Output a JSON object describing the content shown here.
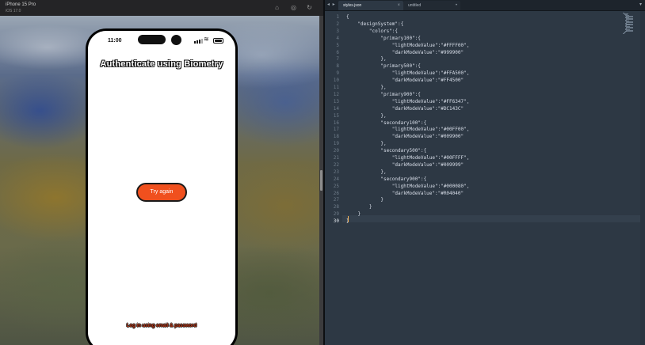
{
  "simulator": {
    "title": "iPhone 15 Pro",
    "subtitle": "iOS 17.0",
    "toolbar_icons": [
      "home-icon",
      "screenshot-icon",
      "rotate-icon"
    ],
    "status_time": "11:00",
    "app_title": "Authenticate using Biometry",
    "try_again_label": "Try again",
    "password_link": "Log in using email & password",
    "accent_color": "#f0501e"
  },
  "editor": {
    "tabs": [
      {
        "label": "styles.json",
        "active": true
      },
      {
        "label": "untitled",
        "active": false
      }
    ],
    "current_line": 30,
    "lines": [
      "{",
      "    \"designSystem\":{",
      "        \"colors\":{",
      "            \"primary100\":{",
      "                \"lightModeValue\":\"#FFFF00\",",
      "                \"darkModeValue\":\"#999900\"",
      "            },",
      "            \"primary500\":{",
      "                \"lightModeValue\":\"#FFA500\",",
      "                \"darkModeValue\":\"#FF4500\"",
      "            },",
      "            \"primary900\":{",
      "                \"lightModeValue\":\"#FF6347\",",
      "                \"darkModeValue\":\"#DC143C\"",
      "            },",
      "            \"secondary100\":{",
      "                \"lightModeValue\":\"#00FF00\",",
      "                \"darkModeValue\":\"#009900\"",
      "            },",
      "            \"secondary500\":{",
      "                \"lightModeValue\":\"#00FFFF\",",
      "                \"darkModeValue\":\"#009999\"",
      "            },",
      "            \"secondary900\":{",
      "                \"lightModeValue\":\"#000080\",",
      "                \"darkModeValue\":\"#R04040\"",
      "            }",
      "        }",
      "    }",
      "}"
    ]
  }
}
